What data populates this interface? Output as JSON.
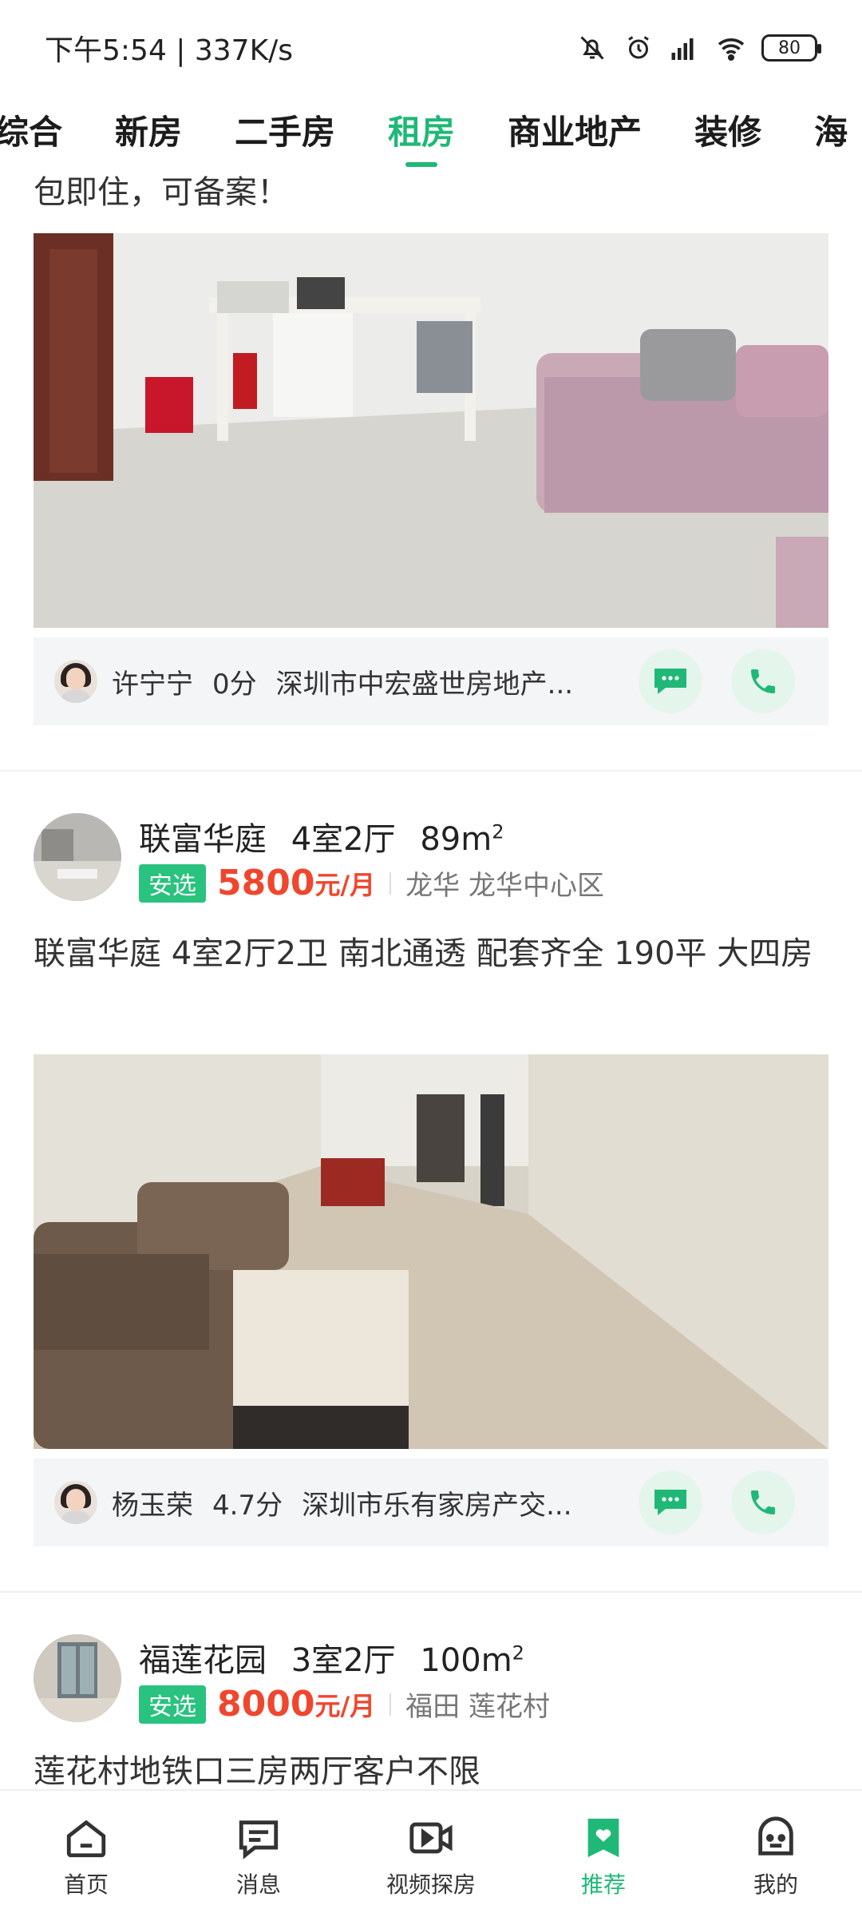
{
  "status_bar": {
    "time_speed": "下午5:54 | 337K/s",
    "battery": "80"
  },
  "tabs": [
    {
      "label": "综合",
      "active": false
    },
    {
      "label": "新房",
      "active": false
    },
    {
      "label": "二手房",
      "active": false
    },
    {
      "label": "租房",
      "active": true
    },
    {
      "label": "商业地产",
      "active": false
    },
    {
      "label": "装修",
      "active": false
    },
    {
      "label": "海",
      "active": false
    }
  ],
  "first_card": {
    "description_tail": "包即住，可备案！",
    "agent": {
      "name": "许宁宁",
      "score": "0分",
      "company": "深圳市中宏盛世房地产..."
    }
  },
  "listings": [
    {
      "community": "联富华庭",
      "layout": "4室2厅",
      "area": "89m",
      "area_unit": "2",
      "badge": "安选",
      "price": "5800",
      "price_unit": "元/月",
      "location": "龙华 龙华中心区",
      "description": "联富华庭 4室2厅2卫 南北通透 配套齐全 190平 大四房",
      "agent": {
        "name": "杨玉荣",
        "score": "4.7分",
        "company": "深圳市乐有家房产交..."
      }
    },
    {
      "community": "福莲花园",
      "layout": "3室2厅",
      "area": "100m",
      "area_unit": "2",
      "badge": "安选",
      "price": "8000",
      "price_unit": "元/月",
      "location": "福田 莲花村",
      "description": "莲花村地铁口三房两厅客户不限"
    }
  ],
  "bottom_nav": [
    {
      "label": "首页",
      "icon": "home-icon"
    },
    {
      "label": "消息",
      "icon": "message-icon"
    },
    {
      "label": "视频探房",
      "icon": "video-icon"
    },
    {
      "label": "推荐",
      "icon": "recommend-heart-icon",
      "active": true
    },
    {
      "label": "我的",
      "icon": "profile-icon"
    }
  ],
  "colors": {
    "accent": "#20b877",
    "price": "#f0462e",
    "badge": "#29c27f"
  }
}
